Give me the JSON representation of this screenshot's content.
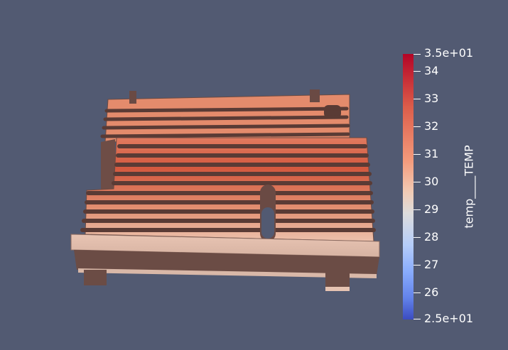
{
  "scalar_bar": {
    "title": "temp____TEMP",
    "max_label": "3.5e+01",
    "min_label": "2.5e+01",
    "tick_labels": [
      "34",
      "33",
      "32",
      "31",
      "30",
      "29",
      "28",
      "27",
      "26"
    ],
    "range": [
      25,
      35
    ],
    "colormap": "Cool to Warm",
    "colors": {
      "high": "#b40426",
      "mid": "#dddcdc",
      "low": "#3b4cc0"
    }
  },
  "scene": {
    "background_color": "#525a72",
    "object": "finned-heatsink-plate"
  }
}
